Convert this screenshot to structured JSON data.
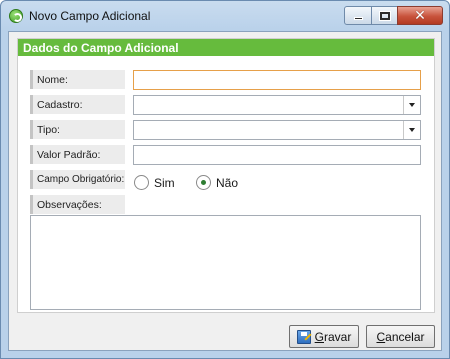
{
  "window": {
    "title": "Novo Campo Adicional",
    "icon": "app-logo-icon"
  },
  "group": {
    "header": "Dados do Campo Adicional",
    "header_color": "#66bb3d"
  },
  "fields": {
    "nome": {
      "label": "Nome:",
      "value": ""
    },
    "cadastro": {
      "label": "Cadastro:",
      "value": ""
    },
    "tipo": {
      "label": "Tipo:",
      "value": ""
    },
    "valor_padrao": {
      "label": "Valor Padrão:",
      "value": ""
    },
    "obrigatorio": {
      "label": "Campo Obrigatório:",
      "options": [
        "Sim",
        "Não"
      ],
      "selected": "Não"
    },
    "observacoes": {
      "label": "Observações:",
      "value": ""
    }
  },
  "buttons": {
    "save": "Gravar",
    "cancel": "Cancelar"
  }
}
